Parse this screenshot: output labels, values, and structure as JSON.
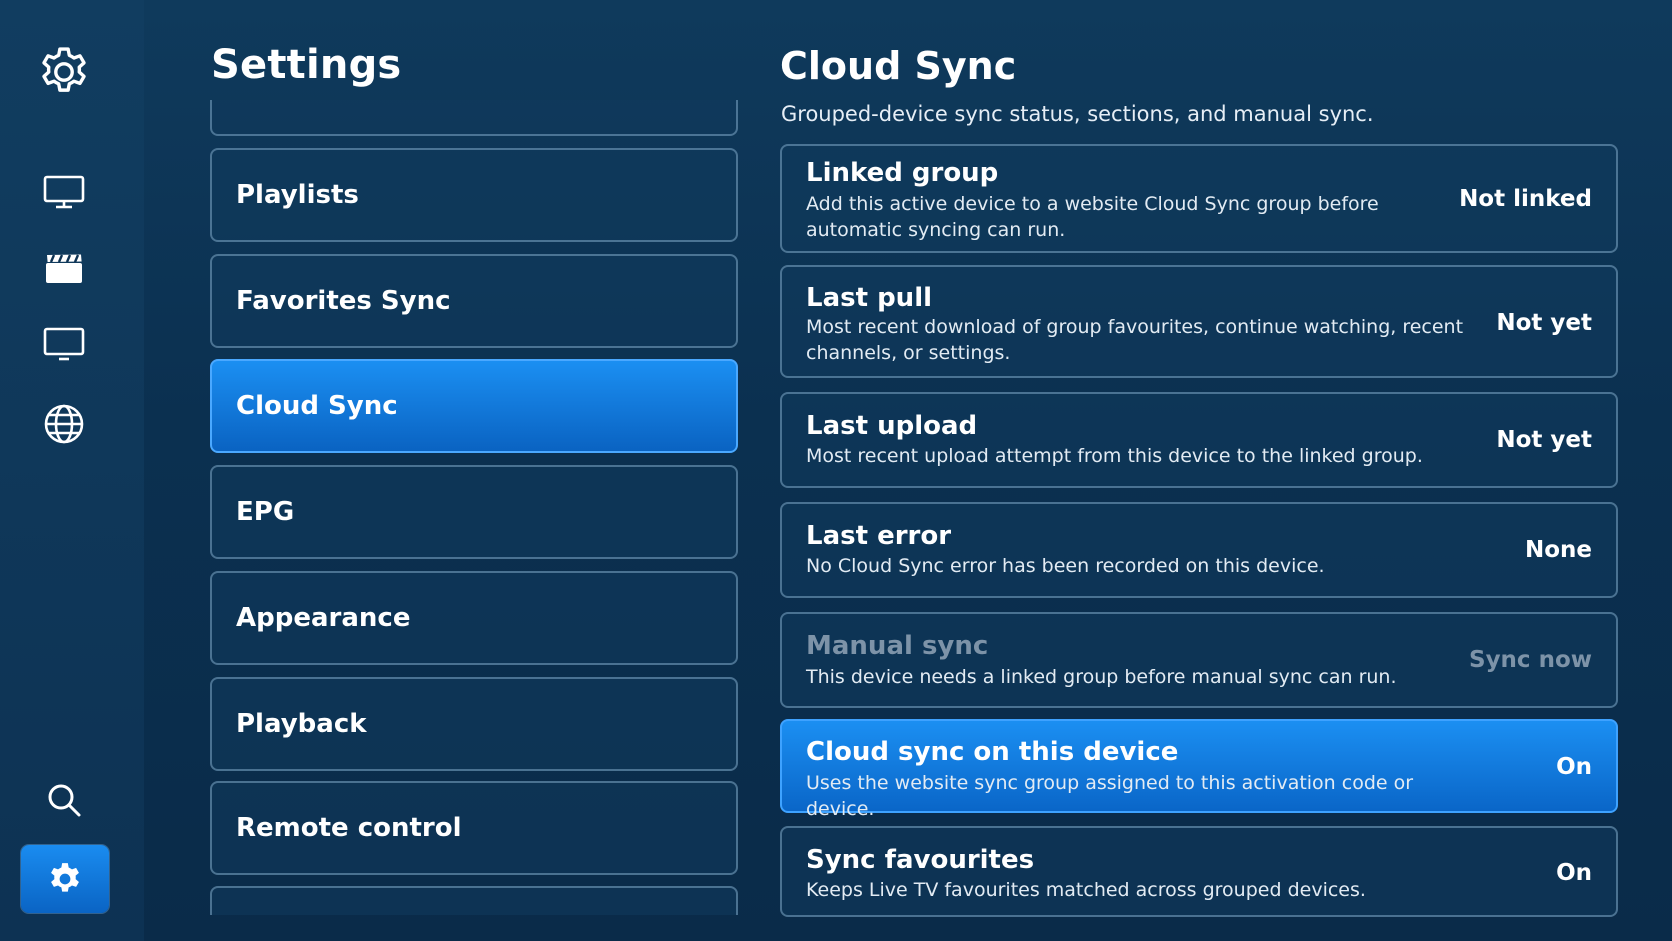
{
  "rail": {
    "items": [
      {
        "icon": "gear-outline-icon"
      },
      {
        "icon": "monitor-icon"
      },
      {
        "icon": "clapperboard-icon"
      },
      {
        "icon": "tv-icon"
      },
      {
        "icon": "globe-icon"
      },
      {
        "icon": "search-icon"
      },
      {
        "icon": "settings-icon",
        "active": true
      }
    ]
  },
  "settings": {
    "title": "Settings",
    "items": [
      {
        "label": ""
      },
      {
        "label": "Playlists"
      },
      {
        "label": "Favorites Sync"
      },
      {
        "label": "Cloud Sync",
        "selected": true
      },
      {
        "label": "EPG"
      },
      {
        "label": "Appearance"
      },
      {
        "label": "Playback"
      },
      {
        "label": "Remote control"
      },
      {
        "label": ""
      }
    ]
  },
  "detail": {
    "title": "Cloud Sync",
    "subtitle": "Grouped-device sync status, sections, and manual sync.",
    "rows": [
      {
        "title": "Linked group",
        "desc": "Add this active device to a website Cloud Sync group before automatic syncing can run.",
        "value": "Not linked"
      },
      {
        "title": "Last pull",
        "desc": "Most recent download of group favourites, continue watching, recent channels, or settings.",
        "value": "Not yet"
      },
      {
        "title": "Last upload",
        "desc": "Most recent upload attempt from this device to the linked group.",
        "value": "Not yet"
      },
      {
        "title": "Last error",
        "desc": "No Cloud Sync error has been recorded on this device.",
        "value": "None"
      },
      {
        "title": "Manual sync",
        "desc": "This device needs a linked group before manual sync can run.",
        "value": "Sync now",
        "disabled": true
      },
      {
        "title": "Cloud sync on this device",
        "desc": "Uses the website sync group assigned to this activation code or device.",
        "value": "On",
        "highlight": true
      },
      {
        "title": "Sync favourites",
        "desc": "Keeps Live TV favourites matched across grouped devices.",
        "value": "On"
      }
    ]
  },
  "colors": {
    "background": "#0b3050",
    "accent": "#1b8ff2",
    "border": "#7fa9c9",
    "disabled_text": "#7d93a8"
  }
}
